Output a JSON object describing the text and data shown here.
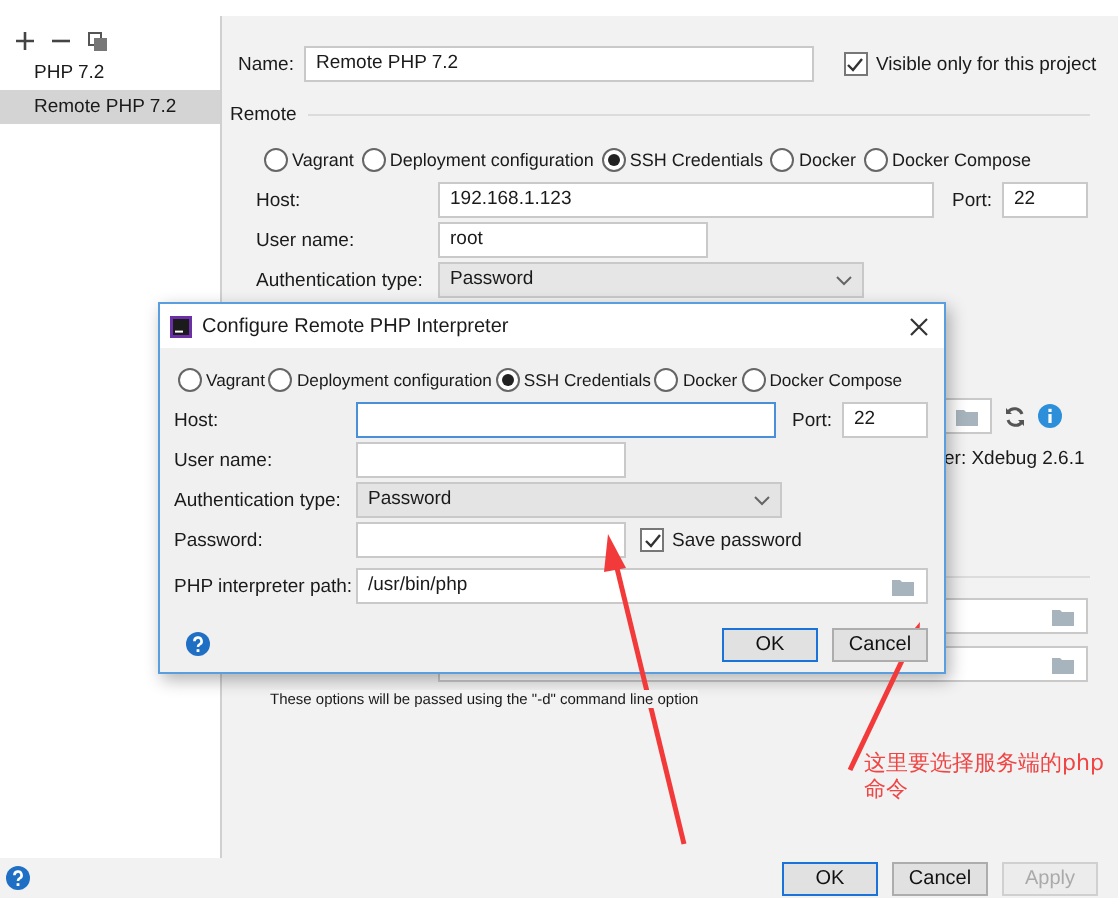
{
  "sidebar": {
    "items": [
      {
        "label": "PHP 7.2",
        "selected": false
      },
      {
        "label": "Remote PHP 7.2",
        "selected": true
      }
    ]
  },
  "settings": {
    "name_label": "Name:",
    "name_value": "Remote PHP 7.2",
    "visible_only": {
      "label": "Visible only for this project",
      "checked": true
    },
    "section": "Remote",
    "connection_types": [
      {
        "label": "Vagrant",
        "selected": false
      },
      {
        "label": "Deployment configuration",
        "selected": false
      },
      {
        "label": "SSH Credentials",
        "selected": true
      },
      {
        "label": "Docker",
        "selected": false
      },
      {
        "label": "Docker Compose",
        "selected": false
      }
    ],
    "host_label": "Host:",
    "host_value": "192.168.1.123",
    "port_label": "Port:",
    "port_value": "22",
    "user_label": "User name:",
    "user_value": "root",
    "auth_label": "Authentication type:",
    "auth_value": "Password",
    "debugger_text": "er: Xdebug 2.6.1",
    "hint": "These options will be passed using the \"-d\" command line option"
  },
  "dialog": {
    "title": "Configure Remote PHP Interpreter",
    "connection_types": [
      {
        "label": "Vagrant",
        "selected": false
      },
      {
        "label": "Deployment configuration",
        "selected": false
      },
      {
        "label": "SSH Credentials",
        "selected": true
      },
      {
        "label": "Docker",
        "selected": false
      },
      {
        "label": "Docker Compose",
        "selected": false
      }
    ],
    "host_label": "Host:",
    "port_label": "Port:",
    "port_value": "22",
    "user_label": "User name:",
    "auth_label": "Authentication type:",
    "auth_value": "Password",
    "password_label": "Password:",
    "save_password": {
      "label": "Save password",
      "checked": true
    },
    "path_label": "PHP interpreter path:",
    "path_value": "/usr/bin/php",
    "buttons": [
      {
        "label": "OK",
        "default": true
      },
      {
        "label": "Cancel",
        "default": false
      }
    ]
  },
  "annotation": {
    "text": "这里要选择服务端的php命令"
  },
  "buttons": [
    {
      "label": "OK",
      "default": true,
      "disabled": false
    },
    {
      "label": "Cancel",
      "default": false,
      "disabled": false
    },
    {
      "label": "Apply",
      "default": false,
      "disabled": true
    }
  ]
}
